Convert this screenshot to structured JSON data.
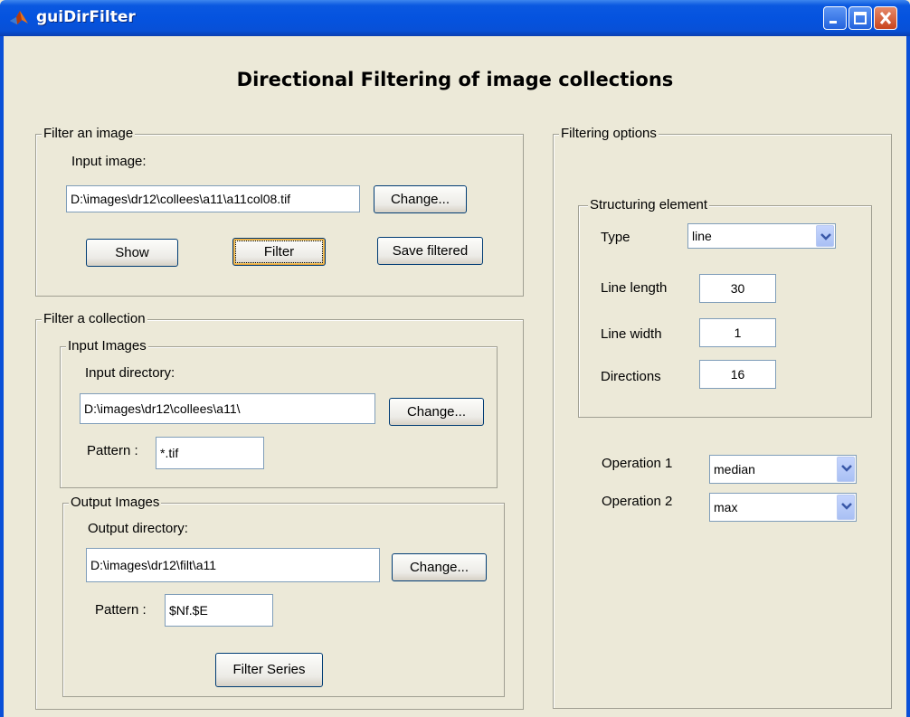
{
  "window": {
    "title": "guiDirFilter"
  },
  "heading": "Directional Filtering of image collections",
  "filter_image": {
    "group_title": "Filter an image",
    "input_label": "Input image:",
    "input_value": "D:\\images\\dr12\\collees\\a11\\a11col08.tif",
    "change_label": "Change...",
    "show_label": "Show",
    "filter_label": "Filter",
    "save_label": "Save filtered"
  },
  "filter_collection": {
    "group_title": "Filter a collection",
    "input_images": {
      "group_title": "Input Images",
      "dir_label": "Input directory:",
      "dir_value": "D:\\images\\dr12\\collees\\a11\\",
      "change_label": "Change...",
      "pattern_label": "Pattern :",
      "pattern_value": "*.tif"
    },
    "output_images": {
      "group_title": "Output Images",
      "dir_label": "Output directory:",
      "dir_value": "D:\\images\\dr12\\filt\\a11",
      "change_label": "Change...",
      "pattern_label": "Pattern :",
      "pattern_value": "$Nf.$E"
    },
    "filter_series_label": "Filter Series"
  },
  "filtering_options": {
    "group_title": "Filtering options",
    "structuring_element": {
      "group_title": "Structuring element",
      "type_label": "Type",
      "type_value": "line",
      "line_length_label": "Line length",
      "line_length_value": "30",
      "line_width_label": "Line width",
      "line_width_value": "1",
      "directions_label": "Directions",
      "directions_value": "16"
    },
    "operation1_label": "Operation 1",
    "operation1_value": "median",
    "operation2_label": "Operation 2",
    "operation2_value": "max"
  },
  "colors": {
    "titlebar": "#0553df",
    "window_bg": "#ece9d8",
    "close_button": "#c9441d"
  }
}
